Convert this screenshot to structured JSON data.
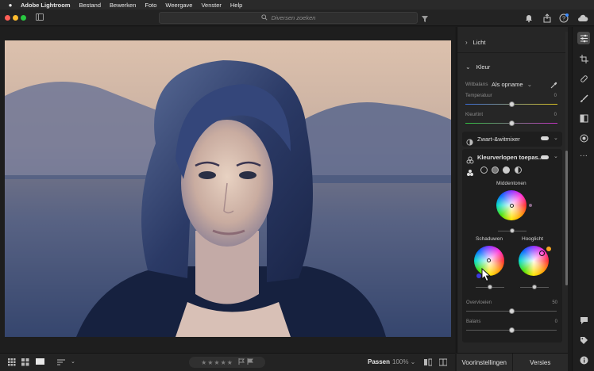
{
  "menubar": {
    "apple": "",
    "app": "Adobe Lightroom",
    "items": [
      "Bestand",
      "Bewerken",
      "Foto",
      "Weergave",
      "Venster",
      "Help"
    ]
  },
  "toolbar": {
    "search_placeholder": "Diversen zoeken"
  },
  "panel": {
    "licht": {
      "label": "Licht"
    },
    "kleur": {
      "label": "Kleur",
      "wb_label": "Witbalans",
      "wb_value": "Als opname",
      "temperatuur": {
        "label": "Temperatuur",
        "value": "0",
        "level": 0.5
      },
      "kleurtint": {
        "label": "Kleurtint",
        "value": "0",
        "level": 0.5
      }
    },
    "bw": {
      "label": "Zwart-&witmixer"
    },
    "grading": {
      "label": "Kleurverlopen toepas...",
      "midtones_label": "Middentonen",
      "shadows_label": "Schaduwen",
      "highlights_label": "Hooglicht",
      "overvloeien": {
        "label": "Overvloeien",
        "value": "50",
        "level": 0.5
      },
      "balans": {
        "label": "Balans",
        "value": "0",
        "level": 0.5
      }
    }
  },
  "bottombar": {
    "stars": "★★★★★",
    "fit": "Passen",
    "zoom": "100% ⌄"
  },
  "tabs": {
    "presets": "Voorinstellingen",
    "versions": "Versies"
  },
  "colors": {
    "accent": "#f5a623",
    "panel_bg": "#262626",
    "photo_tone_highlight": "#e8d2c2",
    "photo_tone_shadow": "#1d2d52"
  }
}
